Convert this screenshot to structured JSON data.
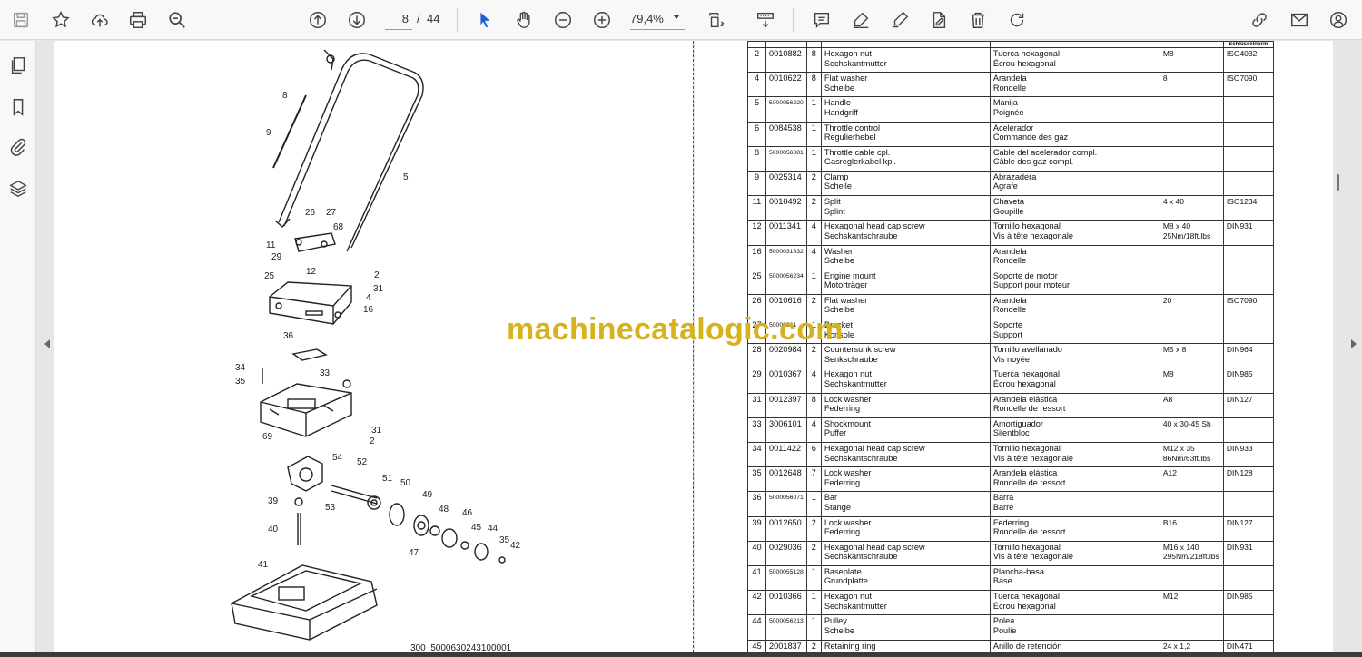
{
  "toolbar": {
    "page_current": "8",
    "page_separator": "/",
    "page_total": "44",
    "zoom": "79,4%"
  },
  "drawing": {
    "caption": "300_5000630243100001",
    "labels": [
      "8",
      "9",
      "5",
      "26",
      "27",
      "68",
      "11",
      "29",
      "12",
      "2",
      "31",
      "4",
      "16",
      "25",
      "36",
      "33",
      "34",
      "35",
      "31",
      "2",
      "69",
      "54",
      "52",
      "51",
      "50",
      "49",
      "48",
      "46",
      "45",
      "44",
      "35",
      "42",
      "47",
      "53",
      "39",
      "40",
      "41"
    ]
  },
  "watermark": "machinecatalogic.com",
  "table": {
    "header": [
      "",
      "",
      "",
      "",
      "",
      "",
      "Schlüsselnorm"
    ],
    "rows": [
      {
        "pos": "2",
        "no": "0010882",
        "qty": "8",
        "en": [
          "Hexagon nut",
          "Sechskantmutter"
        ],
        "es": [
          "Tuerca hexagonal",
          "Écrou hexagonal"
        ],
        "spec": [
          "M8"
        ],
        "std": "ISO4032"
      },
      {
        "pos": "4",
        "no": "0010622",
        "qty": "8",
        "en": [
          "Flat washer",
          "Scheibe"
        ],
        "es": [
          "Arandela",
          "Rondelle"
        ],
        "spec": [
          "8"
        ],
        "std": "ISO7090"
      },
      {
        "pos": "5",
        "no": "5000056220",
        "qty": "1",
        "en": [
          "Handle",
          "Handgriff"
        ],
        "es": [
          "Manija",
          "Poignée"
        ],
        "spec": [
          ""
        ],
        "std": ""
      },
      {
        "pos": "6",
        "no": "0084538",
        "qty": "1",
        "en": [
          "Throttle control",
          "Regulierhebel"
        ],
        "es": [
          "Acelerador",
          "Commande des gaz"
        ],
        "spec": [
          ""
        ],
        "std": ""
      },
      {
        "pos": "8",
        "no": "5000056081",
        "qty": "1",
        "en": [
          "Throttle cable cpl.",
          "Gasreglerkabel kpl."
        ],
        "es": [
          "Cable del acelerador compl.",
          "Câble des gaz compl."
        ],
        "spec": [
          ""
        ],
        "std": ""
      },
      {
        "pos": "9",
        "no": "0025314",
        "qty": "2",
        "en": [
          "Clamp",
          "Schelle"
        ],
        "es": [
          "Abrazadera",
          "Agrafe"
        ],
        "spec": [
          ""
        ],
        "std": ""
      },
      {
        "pos": "11",
        "no": "0010492",
        "qty": "2",
        "en": [
          "Split",
          "Splint"
        ],
        "es": [
          "Chaveta",
          "Goupille"
        ],
        "spec": [
          "4 x 40"
        ],
        "std": "ISO1234"
      },
      {
        "pos": "12",
        "no": "0011341",
        "qty": "4",
        "en": [
          "Hexagonal head cap screw",
          "Sechskantschraube"
        ],
        "es": [
          "Tornillo hexagonal",
          "Vis à tête hexagonale"
        ],
        "spec": [
          "M8 x 40",
          "25Nm/18ft.lbs"
        ],
        "std": "DIN931"
      },
      {
        "pos": "16",
        "no": "5000031632",
        "qty": "4",
        "en": [
          "Washer",
          "Scheibe"
        ],
        "es": [
          "Arandela",
          "Rondelle"
        ],
        "spec": [
          ""
        ],
        "std": ""
      },
      {
        "pos": "25",
        "no": "5000056234",
        "qty": "1",
        "en": [
          "Engine mount",
          "Motorträger"
        ],
        "es": [
          "Soporte de motor",
          "Support pour moteur"
        ],
        "spec": [
          ""
        ],
        "std": ""
      },
      {
        "pos": "26",
        "no": "0010616",
        "qty": "2",
        "en": [
          "Flat washer",
          "Scheibe"
        ],
        "es": [
          "Arandela",
          "Rondelle"
        ],
        "spec": [
          "20"
        ],
        "std": "ISO7090"
      },
      {
        "pos": "27",
        "no": "50000561",
        "qty": "1",
        "en": [
          "Bracket",
          "Konsole"
        ],
        "es": [
          "Soporte",
          "Support"
        ],
        "spec": [
          ""
        ],
        "std": ""
      },
      {
        "pos": "28",
        "no": "0020984",
        "qty": "2",
        "en": [
          "Countersunk screw",
          "Senkschraube"
        ],
        "es": [
          "Tornillo avellanado",
          "Vis noyée"
        ],
        "spec": [
          "M5 x 8"
        ],
        "std": "DIN964"
      },
      {
        "pos": "29",
        "no": "0010367",
        "qty": "4",
        "en": [
          "Hexagon nut",
          "Sechskantmutter"
        ],
        "es": [
          "Tuerca hexagonal",
          "Écrou hexagonal"
        ],
        "spec": [
          "M8"
        ],
        "std": "DIN985"
      },
      {
        "pos": "31",
        "no": "0012397",
        "qty": "8",
        "en": [
          "Lock washer",
          "Federring"
        ],
        "es": [
          "Arandela elástica",
          "Rondelle de ressort"
        ],
        "spec": [
          "A8"
        ],
        "std": "DIN127"
      },
      {
        "pos": "33",
        "no": "3006101",
        "qty": "4",
        "en": [
          "Shockmount",
          "Puffer"
        ],
        "es": [
          "Amortiguador",
          "Silentbloc"
        ],
        "spec": [
          "40 x 30-45 Sh"
        ],
        "std": ""
      },
      {
        "pos": "34",
        "no": "0011422",
        "qty": "6",
        "en": [
          "Hexagonal head cap screw",
          "Sechskantschraube"
        ],
        "es": [
          "Tornillo hexagonal",
          "Vis à tête hexagonale"
        ],
        "spec": [
          "M12 x 35",
          "86Nm/63ft.lbs"
        ],
        "std": "DIN933"
      },
      {
        "pos": "35",
        "no": "0012648",
        "qty": "7",
        "en": [
          "Lock washer",
          "Federring"
        ],
        "es": [
          "Arandela elástica",
          "Rondelle de ressort"
        ],
        "spec": [
          "A12"
        ],
        "std": "DIN128"
      },
      {
        "pos": "36",
        "no": "5000056071",
        "qty": "1",
        "en": [
          "Bar",
          "Stange"
        ],
        "es": [
          "Barra",
          "Barre"
        ],
        "spec": [
          ""
        ],
        "std": ""
      },
      {
        "pos": "39",
        "no": "0012650",
        "qty": "2",
        "en": [
          "Lock washer",
          "Federring"
        ],
        "es": [
          "Federring",
          "Rondelle de ressort"
        ],
        "spec": [
          "B16"
        ],
        "std": "DIN127"
      },
      {
        "pos": "40",
        "no": "0029036",
        "qty": "2",
        "en": [
          "Hexagonal head cap screw",
          "Sechskantschraube"
        ],
        "es": [
          "Tornillo hexagonal",
          "Vis à tête hexagonale"
        ],
        "spec": [
          "M16 x 140",
          "295Nm/218ft.lbs"
        ],
        "std": "DIN931"
      },
      {
        "pos": "41",
        "no": "5000055128",
        "qty": "1",
        "en": [
          "Baseplate",
          "Grundplatte"
        ],
        "es": [
          "Plancha-basa",
          "Base"
        ],
        "spec": [
          ""
        ],
        "std": ""
      },
      {
        "pos": "42",
        "no": "0010366",
        "qty": "1",
        "en": [
          "Hexagon nut",
          "Sechskantmutter"
        ],
        "es": [
          "Tuerca hexagonal",
          "Écrou hexagonal"
        ],
        "spec": [
          "M12"
        ],
        "std": "DIN985"
      },
      {
        "pos": "44",
        "no": "5000056213",
        "qty": "1",
        "en": [
          "Pulley",
          "Scheibe"
        ],
        "es": [
          "Polea",
          "Poulie"
        ],
        "spec": [
          ""
        ],
        "std": ""
      },
      {
        "pos": "45",
        "no": "2001837",
        "qty": "2",
        "en": [
          "Retaining ring",
          "Sicherungsring"
        ],
        "es": [
          "Anillo de retención",
          "Bague d'arrêt"
        ],
        "spec": [
          "24 x 1,2"
        ],
        "std": "DIN471"
      }
    ]
  }
}
